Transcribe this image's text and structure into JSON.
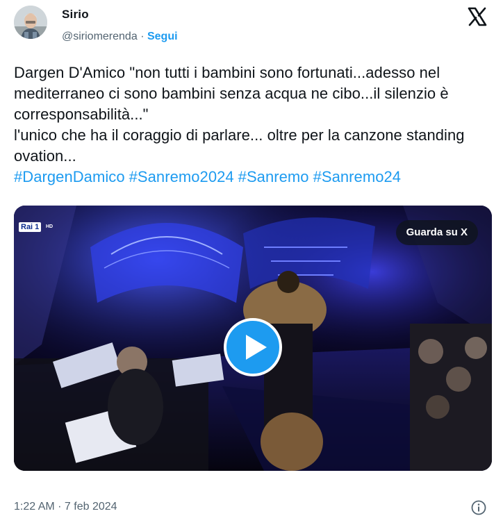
{
  "author": {
    "name": "Sirio",
    "handle": "@siriomerenda",
    "separator": "·",
    "follow_label": "Segui",
    "avatar_icon": "bernie-sanders-avatar"
  },
  "tweet": {
    "lines": [
      "Dargen D'Amico \"non tutti i bambini sono fortunati...adesso nel mediterraneo ci sono bambini senza acqua ne cibo...il silenzio è corresponsabilità...\"",
      "l'unico che ha il coraggio di parlare... oltre per la canzone standing ovation..."
    ],
    "hashtags": [
      "#DargenDamico",
      "#Sanremo2024",
      "#Sanremo",
      "#Sanremo24"
    ]
  },
  "media": {
    "channel_logo": "Rai 1",
    "channel_sub": "HD",
    "watch_label": "Guarda su X",
    "play_icon": "play-icon"
  },
  "footer": {
    "timestamp": "1:22 AM · 7 feb 2024",
    "info_icon": "info-icon"
  },
  "colors": {
    "link": "#1d9bf0",
    "secondary_text": "#536471",
    "stage_blue": "#3a4cff"
  }
}
